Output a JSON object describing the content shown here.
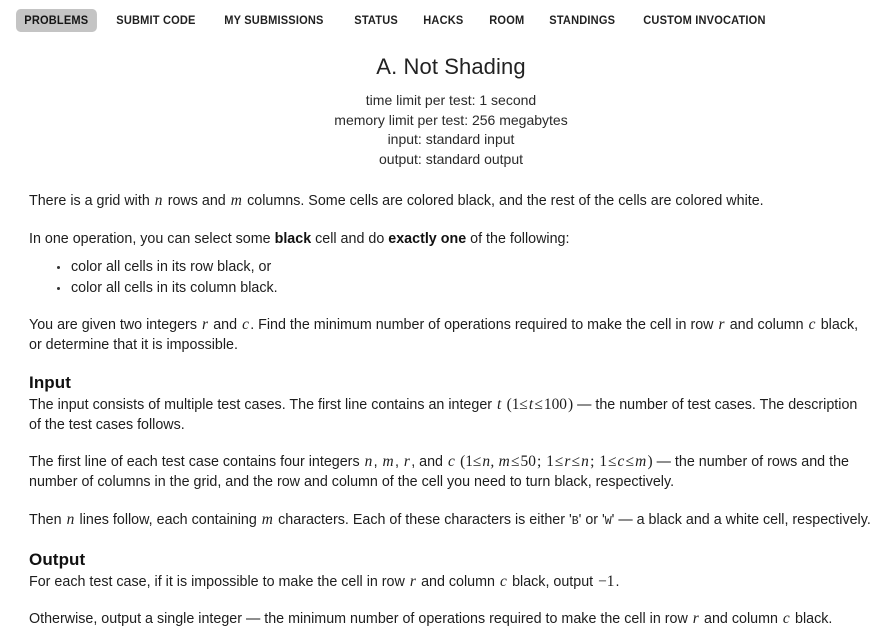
{
  "nav": {
    "items": [
      {
        "label": "PROBLEMS",
        "active": true
      },
      {
        "label": "SUBMIT CODE",
        "active": false
      },
      {
        "label": "MY SUBMISSIONS",
        "active": false
      },
      {
        "label": "STATUS",
        "active": false
      },
      {
        "label": "HACKS",
        "active": false
      },
      {
        "label": "ROOM",
        "active": false
      },
      {
        "label": "STANDINGS",
        "active": false
      },
      {
        "label": "CUSTOM INVOCATION",
        "active": false
      }
    ]
  },
  "problem": {
    "title": "A. Not Shading",
    "limits": {
      "time": "time limit per test: 1 second",
      "memory": "memory limit per test: 256 megabytes",
      "input": "input: standard input",
      "output": "output: standard output"
    },
    "intro": {
      "p1_a": "There is a grid with ",
      "p1_n": "n",
      "p1_b": " rows and ",
      "p1_m": "m",
      "p1_c": " columns. Some cells are colored black, and the rest of the cells are colored white.",
      "p2_a": "In one operation, you can select some ",
      "p2_black": "black",
      "p2_b": " cell and do ",
      "p2_exactly": "exactly one",
      "p2_c": " of the following:"
    },
    "operations": [
      "color all cells in its row black, or",
      "color all cells in its column black."
    ],
    "given": {
      "a": "You are given two integers ",
      "r": "r",
      "b": " and ",
      "c": "c",
      "d": ". Find the minimum number of operations required to make the cell in row ",
      "r2": "r",
      "e": " and column ",
      "c2": "c",
      "f": " black, or determine that it is impossible."
    },
    "input_section": {
      "heading": "Input",
      "p1_a": "The input consists of multiple test cases. The first line contains an integer ",
      "p1_t": "t",
      "p1_paren_open": "(1",
      "p1_le1": "≤",
      "p1_t2": "t",
      "p1_le2": "≤",
      "p1_100": "100",
      "p1_paren_close": ")",
      "p1_b": " — the number of test cases. The description of the test cases follows.",
      "p2_a": "The first line of each test case contains four integers ",
      "p2_n": "n",
      "p2_comma1": ", ",
      "p2_m": "m",
      "p2_comma2": ", ",
      "p2_r": "r",
      "p2_and": ", and ",
      "p2_c": "c",
      "p2_constraint_open": "(1",
      "p2_le1": "≤",
      "p2_nm": "n, m",
      "p2_le2": "≤",
      "p2_50": "50",
      "p2_semi1": ";",
      "p2_one2": "1",
      "p2_le3": "≤",
      "p2_r2": "r",
      "p2_le4": "≤",
      "p2_n2": "n",
      "p2_semi2": ";",
      "p2_one3": "1",
      "p2_le5": "≤",
      "p2_c2": "c",
      "p2_le6": "≤",
      "p2_m2": "m",
      "p2_constraint_close": ")",
      "p2_b": " — the number of rows and the number of columns in the grid, and the row and column of the cell you need to turn black, respectively.",
      "p3_a": "Then ",
      "p3_n": "n",
      "p3_b": " lines follow, each containing ",
      "p3_m": "m",
      "p3_c": " characters. Each of these characters is either '",
      "p3_black_char": "B",
      "p3_d": "' or '",
      "p3_white_char": "W",
      "p3_e": "' — a black and a white cell, respectively."
    },
    "output_section": {
      "heading": "Output",
      "p1_a": "For each test case, if it is impossible to make the cell in row ",
      "p1_r": "r",
      "p1_b": " and column ",
      "p1_c": "c",
      "p1_c2": " black, output ",
      "p1_minus1": "−1",
      "p1_d": ".",
      "p2_a": "Otherwise, output a single integer — the minimum number of operations required to make the cell in row ",
      "p2_r": "r",
      "p2_b": " and column ",
      "p2_c": "c",
      "p2_d": " black."
    }
  }
}
